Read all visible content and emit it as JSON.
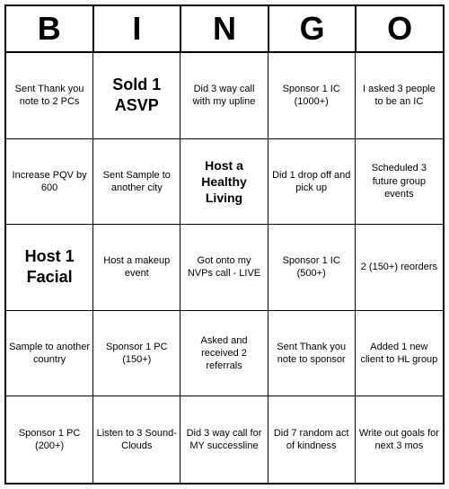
{
  "header": {
    "letters": [
      "B",
      "I",
      "N",
      "G",
      "O"
    ]
  },
  "cells": [
    {
      "text": "Sent Thank you note to 2 PCs",
      "size": "small"
    },
    {
      "text": "Sold 1 ASVP",
      "size": "large"
    },
    {
      "text": "Did 3 way call with my upline",
      "size": "small"
    },
    {
      "text": "Sponsor 1 IC (1000+)",
      "size": "small"
    },
    {
      "text": "I asked 3 people to be an IC",
      "size": "small"
    },
    {
      "text": "Increase PQV by 600",
      "size": "small"
    },
    {
      "text": "Sent Sample to another city",
      "size": "small"
    },
    {
      "text": "Host a Healthy Living",
      "size": "medium"
    },
    {
      "text": "Did 1 drop off and pick up",
      "size": "small"
    },
    {
      "text": "Scheduled 3 future group events",
      "size": "small"
    },
    {
      "text": "Host 1 Facial",
      "size": "large"
    },
    {
      "text": "Host a makeup event",
      "size": "small"
    },
    {
      "text": "Got onto my NVPs call - LIVE",
      "size": "small"
    },
    {
      "text": "Sponsor 1 IC (500+)",
      "size": "small"
    },
    {
      "text": "2 (150+) reorders",
      "size": "small"
    },
    {
      "text": "Sample to another country",
      "size": "small"
    },
    {
      "text": "Sponsor 1 PC (150+)",
      "size": "small"
    },
    {
      "text": "Asked and received 2 referrals",
      "size": "small"
    },
    {
      "text": "Sent Thank you note to sponsor",
      "size": "small"
    },
    {
      "text": "Added 1 new client to HL group",
      "size": "small"
    },
    {
      "text": "Sponsor 1 PC (200+)",
      "size": "small"
    },
    {
      "text": "Listen to 3 Sound-Clouds",
      "size": "small"
    },
    {
      "text": "Did 3 way call for MY successline",
      "size": "small"
    },
    {
      "text": "Did 7 random act of kindness",
      "size": "small"
    },
    {
      "text": "Write out goals for next 3 mos",
      "size": "small"
    }
  ]
}
